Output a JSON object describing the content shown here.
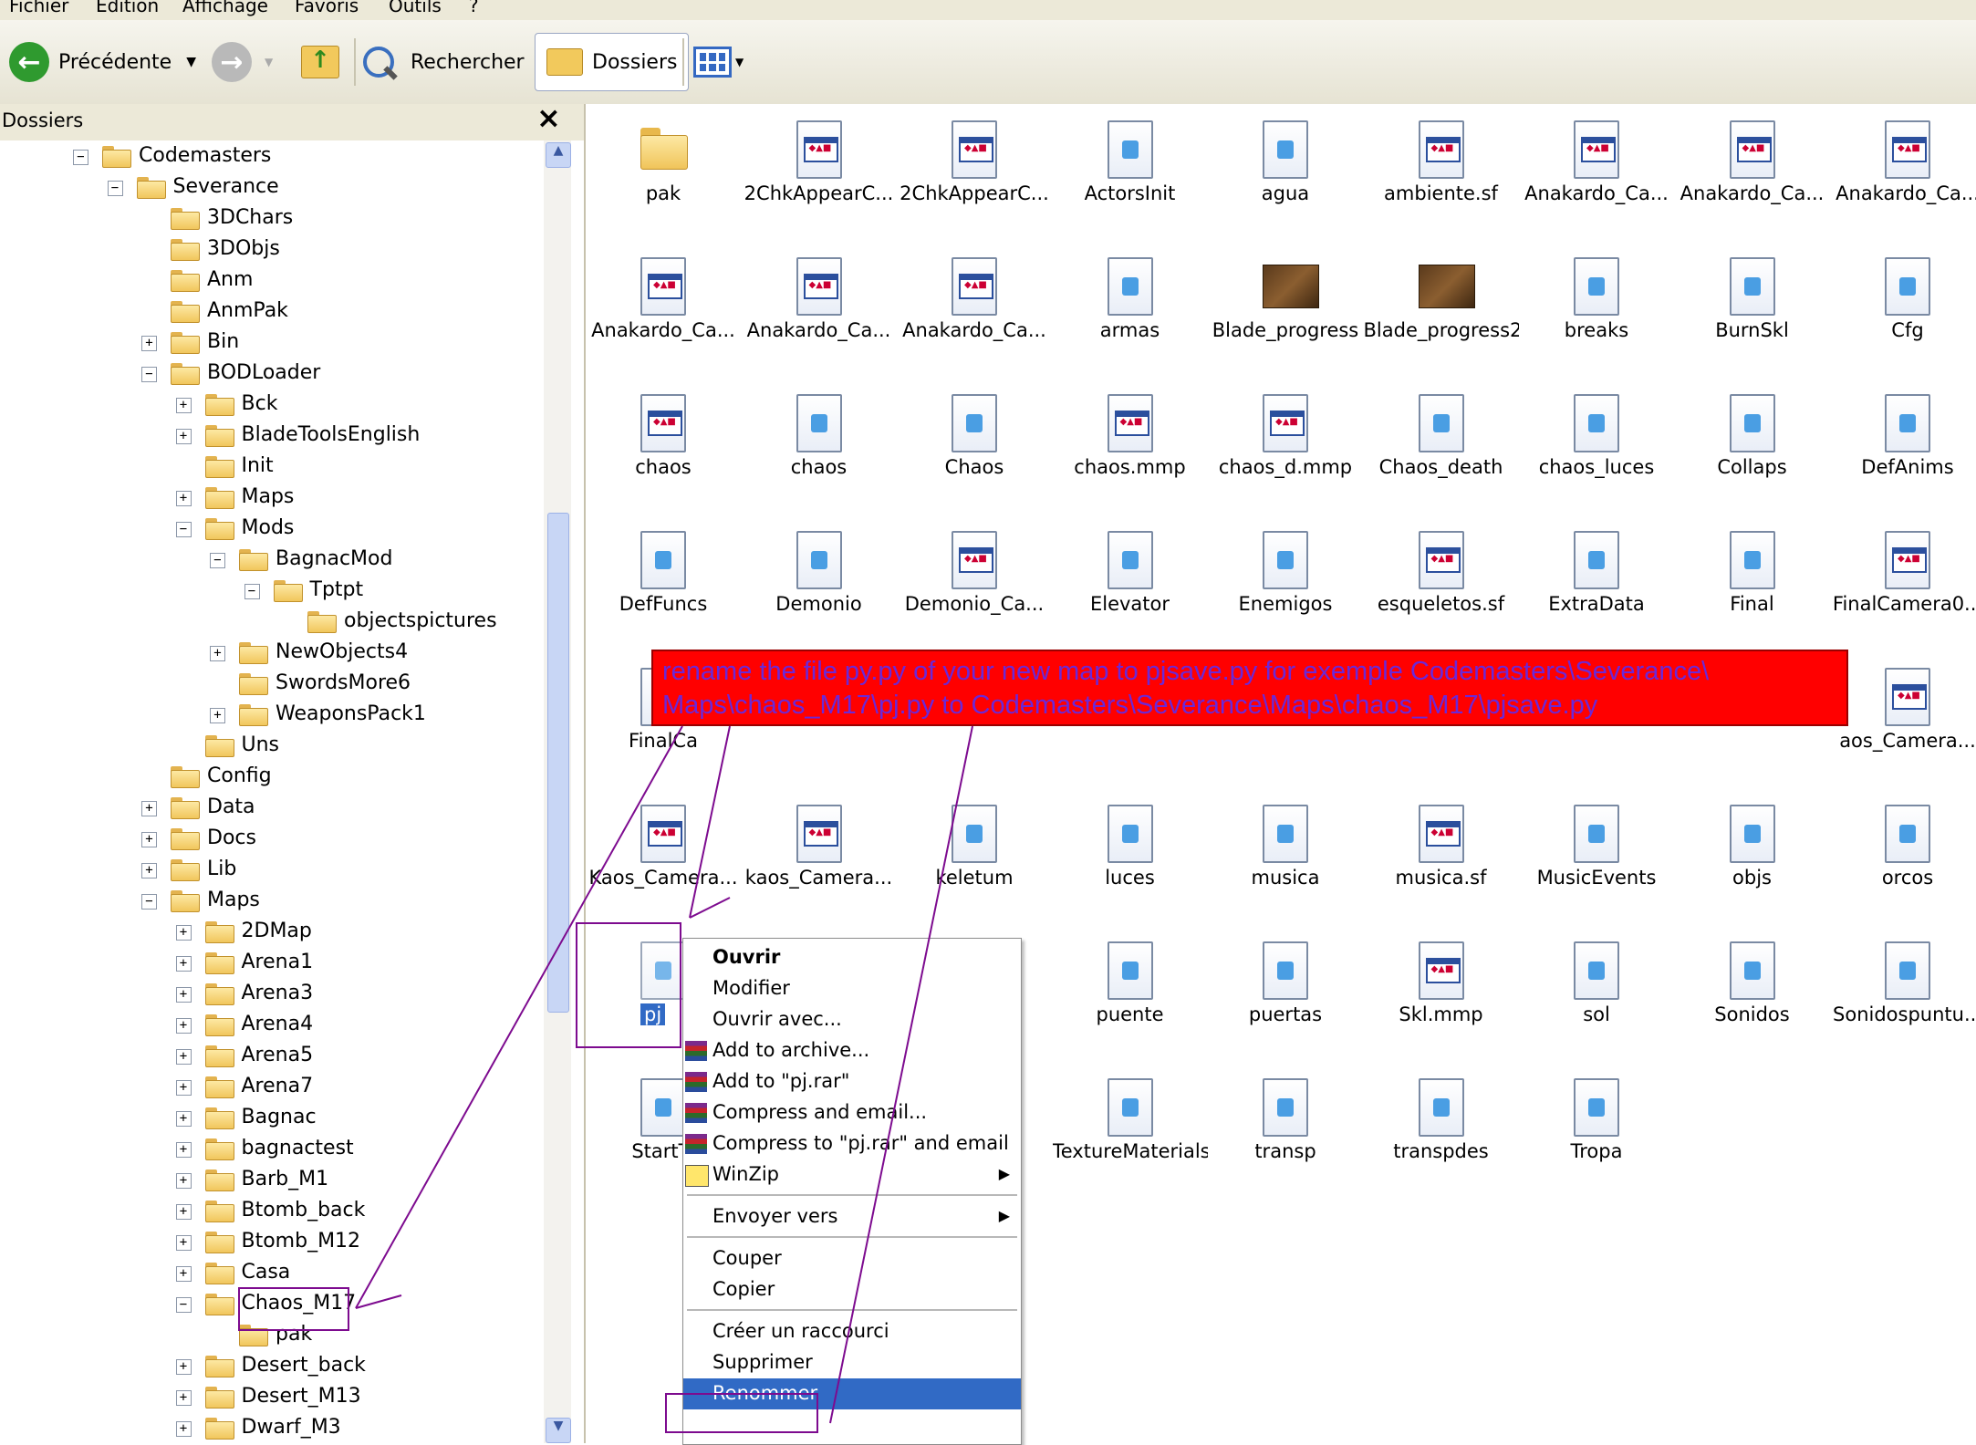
{
  "menu": [
    "Fichier",
    "Edition",
    "Affichage",
    "Favoris",
    "Outils",
    "?"
  ],
  "toolbar": {
    "back_label": "Précédente",
    "search_label": "Rechercher",
    "folders_label": "Dossiers"
  },
  "panel": {
    "title": "Dossiers",
    "close": "×"
  },
  "tree": [
    {
      "label": "Codemasters",
      "level": 0,
      "expander": "minus"
    },
    {
      "label": "Severance",
      "level": 1,
      "expander": "minus"
    },
    {
      "label": "3DChars",
      "level": 2,
      "expander": "none"
    },
    {
      "label": "3DObjs",
      "level": 2,
      "expander": "none"
    },
    {
      "label": "Anm",
      "level": 2,
      "expander": "none"
    },
    {
      "label": "AnmPak",
      "level": 2,
      "expander": "none"
    },
    {
      "label": "Bin",
      "level": 2,
      "expander": "plus"
    },
    {
      "label": "BODLoader",
      "level": 2,
      "expander": "minus"
    },
    {
      "label": "Bck",
      "level": 3,
      "expander": "plus"
    },
    {
      "label": "BladeToolsEnglish",
      "level": 3,
      "expander": "plus"
    },
    {
      "label": "Init",
      "level": 3,
      "expander": "none"
    },
    {
      "label": "Maps",
      "level": 3,
      "expander": "plus"
    },
    {
      "label": "Mods",
      "level": 3,
      "expander": "minus"
    },
    {
      "label": "BagnacMod",
      "level": 4,
      "expander": "minus"
    },
    {
      "label": "Tptpt",
      "level": 5,
      "expander": "minus"
    },
    {
      "label": "objectspictures",
      "level": 6,
      "expander": "none"
    },
    {
      "label": "NewObjects4",
      "level": 4,
      "expander": "plus"
    },
    {
      "label": "SwordsMore6",
      "level": 4,
      "expander": "none"
    },
    {
      "label": "WeaponsPack1",
      "level": 4,
      "expander": "plus"
    },
    {
      "label": "Uns",
      "level": 3,
      "expander": "none"
    },
    {
      "label": "Config",
      "level": 2,
      "expander": "none"
    },
    {
      "label": "Data",
      "level": 2,
      "expander": "plus"
    },
    {
      "label": "Docs",
      "level": 2,
      "expander": "plus"
    },
    {
      "label": "Lib",
      "level": 2,
      "expander": "plus"
    },
    {
      "label": "Maps",
      "level": 2,
      "expander": "minus"
    },
    {
      "label": "2DMap",
      "level": 3,
      "expander": "plus"
    },
    {
      "label": "Arena1",
      "level": 3,
      "expander": "plus"
    },
    {
      "label": "Arena3",
      "level": 3,
      "expander": "plus"
    },
    {
      "label": "Arena4",
      "level": 3,
      "expander": "plus"
    },
    {
      "label": "Arena5",
      "level": 3,
      "expander": "plus"
    },
    {
      "label": "Arena7",
      "level": 3,
      "expander": "plus"
    },
    {
      "label": "Bagnac",
      "level": 3,
      "expander": "plus"
    },
    {
      "label": "bagnactest",
      "level": 3,
      "expander": "plus"
    },
    {
      "label": "Barb_M1",
      "level": 3,
      "expander": "plus"
    },
    {
      "label": "Btomb_back",
      "level": 3,
      "expander": "plus"
    },
    {
      "label": "Btomb_M12",
      "level": 3,
      "expander": "plus"
    },
    {
      "label": "Casa",
      "level": 3,
      "expander": "plus"
    },
    {
      "label": "Chaos_M17",
      "level": 3,
      "expander": "minus"
    },
    {
      "label": "pak",
      "level": 4,
      "expander": "none"
    },
    {
      "label": "Desert_back",
      "level": 3,
      "expander": "plus"
    },
    {
      "label": "Desert_M13",
      "level": 3,
      "expander": "plus"
    },
    {
      "label": "Dwarf_M3",
      "level": 3,
      "expander": "plus"
    }
  ],
  "files": [
    {
      "name": "pak",
      "icon": "folder-icon"
    },
    {
      "name": "2ChkAppearC...",
      "icon": "app-icon"
    },
    {
      "name": "2ChkAppearC...",
      "icon": "app-icon"
    },
    {
      "name": "ActorsInit",
      "icon": "doc-icon"
    },
    {
      "name": "agua",
      "icon": "doc-icon"
    },
    {
      "name": "ambiente.sf",
      "icon": "app-icon"
    },
    {
      "name": "Anakardo_Ca...",
      "icon": "app-icon"
    },
    {
      "name": "Anakardo_Ca...",
      "icon": "app-icon"
    },
    {
      "name": "Anakardo_Ca...",
      "icon": "app-icon"
    },
    {
      "name": "Anakardo_Ca...",
      "icon": "app-icon"
    },
    {
      "name": "Anakardo_Ca...",
      "icon": "app-icon"
    },
    {
      "name": "Anakardo_Ca...",
      "icon": "app-icon"
    },
    {
      "name": "armas",
      "icon": "doc-icon"
    },
    {
      "name": "Blade_progress",
      "icon": "image-icon"
    },
    {
      "name": "Blade_progress2",
      "icon": "image-icon"
    },
    {
      "name": "breaks",
      "icon": "doc-icon"
    },
    {
      "name": "BurnSkl",
      "icon": "doc-icon"
    },
    {
      "name": "Cfg",
      "icon": "doc-icon"
    },
    {
      "name": "chaos",
      "icon": "app-icon"
    },
    {
      "name": "chaos",
      "icon": "doc-icon"
    },
    {
      "name": "Chaos",
      "icon": "doc-icon"
    },
    {
      "name": "chaos.mmp",
      "icon": "app-icon"
    },
    {
      "name": "chaos_d.mmp",
      "icon": "app-icon"
    },
    {
      "name": "Chaos_death",
      "icon": "doc-icon"
    },
    {
      "name": "chaos_luces",
      "icon": "doc-icon"
    },
    {
      "name": "Collaps",
      "icon": "doc-icon"
    },
    {
      "name": "DefAnims",
      "icon": "doc-icon"
    },
    {
      "name": "DefFuncs",
      "icon": "doc-icon"
    },
    {
      "name": "Demonio",
      "icon": "doc-icon"
    },
    {
      "name": "Demonio_Ca...",
      "icon": "app-icon"
    },
    {
      "name": "Elevator",
      "icon": "doc-icon"
    },
    {
      "name": "Enemigos",
      "icon": "doc-icon"
    },
    {
      "name": "esqueletos.sf",
      "icon": "app-icon"
    },
    {
      "name": "ExtraData",
      "icon": "doc-icon"
    },
    {
      "name": "Final",
      "icon": "doc-icon"
    },
    {
      "name": "FinalCamera0...",
      "icon": "app-icon"
    },
    {
      "name": "FinalCa",
      "icon": "doc-icon"
    },
    {
      "name": "",
      "icon": "none"
    },
    {
      "name": "",
      "icon": "none"
    },
    {
      "name": "",
      "icon": "none"
    },
    {
      "name": "",
      "icon": "none"
    },
    {
      "name": "",
      "icon": "none"
    },
    {
      "name": "",
      "icon": "none"
    },
    {
      "name": "",
      "icon": "none"
    },
    {
      "name": "aos_Camera...",
      "icon": "app-icon"
    },
    {
      "name": "Kaos_Camera...",
      "icon": "app-icon"
    },
    {
      "name": "kaos_Camera...",
      "icon": "app-icon"
    },
    {
      "name": "keletum",
      "icon": "doc-icon"
    },
    {
      "name": "luces",
      "icon": "doc-icon"
    },
    {
      "name": "musica",
      "icon": "doc-icon"
    },
    {
      "name": "musica.sf",
      "icon": "app-icon"
    },
    {
      "name": "MusicEvents",
      "icon": "doc-icon"
    },
    {
      "name": "objs",
      "icon": "doc-icon"
    },
    {
      "name": "orcos",
      "icon": "doc-icon"
    },
    {
      "name": "pj",
      "icon": "doc-icon"
    },
    {
      "name": "",
      "icon": "none"
    },
    {
      "name": "",
      "icon": "none"
    },
    {
      "name": "puente",
      "icon": "doc-icon"
    },
    {
      "name": "puertas",
      "icon": "doc-icon"
    },
    {
      "name": "Skl.mmp",
      "icon": "app-icon"
    },
    {
      "name": "sol",
      "icon": "doc-icon"
    },
    {
      "name": "Sonidos",
      "icon": "doc-icon"
    },
    {
      "name": "Sonidospuntu...",
      "icon": "doc-icon"
    },
    {
      "name": "StartTi",
      "icon": "doc-icon"
    },
    {
      "name": "",
      "icon": "none"
    },
    {
      "name": "",
      "icon": "none"
    },
    {
      "name": "TextureMaterials",
      "icon": "doc-icon"
    },
    {
      "name": "transp",
      "icon": "doc-icon"
    },
    {
      "name": "transpdes",
      "icon": "doc-icon"
    },
    {
      "name": "Tropa",
      "icon": "doc-icon"
    },
    {
      "name": "",
      "icon": "none"
    },
    {
      "name": "",
      "icon": "none"
    }
  ],
  "context_menu": [
    {
      "label": "Ouvrir",
      "bold": true,
      "icon": ""
    },
    {
      "label": "Modifier",
      "icon": ""
    },
    {
      "label": "Ouvrir avec...",
      "icon": ""
    },
    {
      "label": "Add to archive...",
      "icon": "rar-icon"
    },
    {
      "label": "Add to \"pj.rar\"",
      "icon": "rar-icon"
    },
    {
      "label": "Compress and email...",
      "icon": "rar-icon"
    },
    {
      "label": "Compress to \"pj.rar\" and email",
      "icon": "rar-icon"
    },
    {
      "label": "WinZip",
      "icon": "winzip-icon",
      "submenu": true
    },
    {
      "sep": true
    },
    {
      "label": "Envoyer vers",
      "icon": "",
      "submenu": true
    },
    {
      "sep": true
    },
    {
      "label": "Couper",
      "icon": ""
    },
    {
      "label": "Copier",
      "icon": ""
    },
    {
      "sep": true
    },
    {
      "label": "Créer un raccourci",
      "icon": ""
    },
    {
      "label": "Supprimer",
      "icon": ""
    },
    {
      "label": "Renommer",
      "icon": "",
      "highlighted": true
    }
  ],
  "annotation": {
    "text": "rename the file py.py of your new map to pjsave.py for exemple  Codemasters\\Severance\\ Maps\\chaos_M17\\pj.py to Codemasters\\Severance\\Maps\\chaos_M17\\pjsave.py",
    "line_color": "#7d0b8f",
    "box_color": "#ff0000",
    "text_color": "#6b28d8"
  },
  "colors": {
    "selection": "#316ac5",
    "toolbar_bg": "#ece9d8"
  }
}
